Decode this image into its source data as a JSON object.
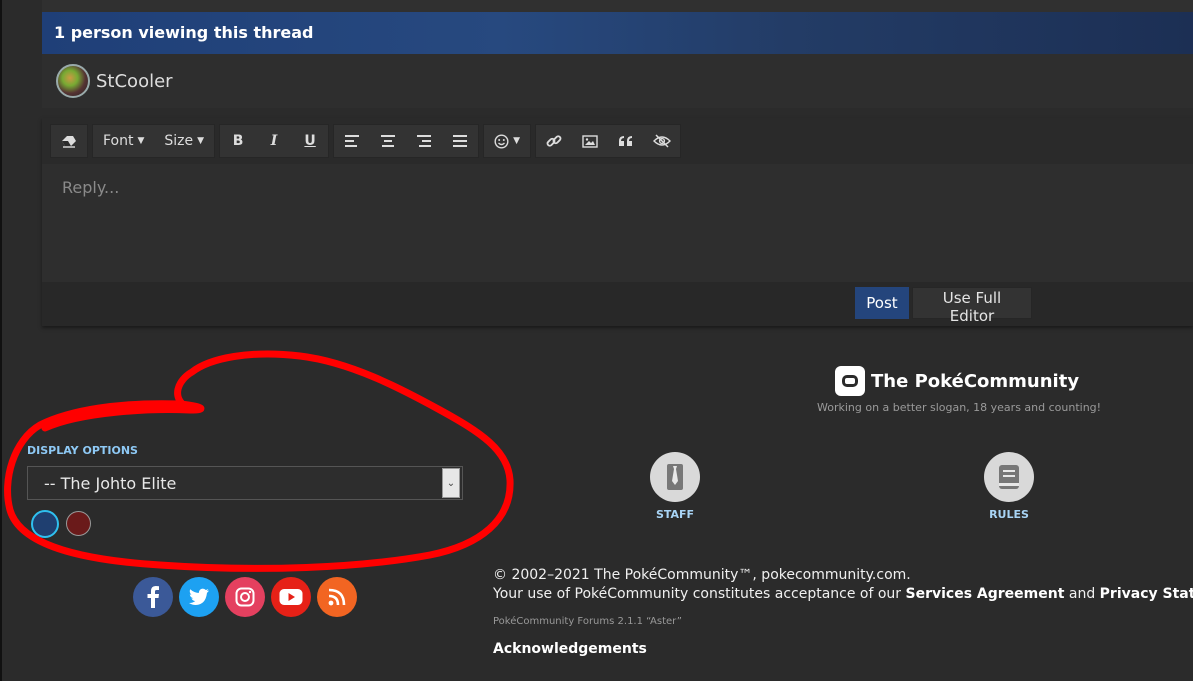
{
  "thread": {
    "viewing_text": "1 person viewing this thread",
    "viewer_name": "StCooler"
  },
  "editor": {
    "font_label": "Font",
    "size_label": "Size",
    "bold_label": "B",
    "italic_label": "I",
    "underline_label": "U",
    "placeholder": "Reply...",
    "post_label": "Post",
    "full_editor_label": "Use Full Editor"
  },
  "brand": {
    "name": "The PokéCommunity",
    "slogan": "Working on a better slogan, 18 years and counting!"
  },
  "footer_links": {
    "staff": "STAFF",
    "rules": "RULES"
  },
  "display_options": {
    "label": "DISPLAY OPTIONS",
    "selected_style": "-- The Johto Elite"
  },
  "footer": {
    "copyright": "© 2002–2021 The PokéCommunity™, pokecommunity.com.",
    "usage_prefix": "Your use of PokéCommunity constitutes acceptance of our ",
    "services_agreement": "Services Agreement",
    "usage_and": " and ",
    "privacy_statement": "Privacy Statement",
    "usage_suffix": ".",
    "version": "PokéCommunity Forums 2.1.1 “Aster”",
    "acknowledgements": "Acknowledgements"
  },
  "colors": {
    "accent_blue": "#24457c",
    "annotation_red": "#ff0000",
    "swatch_blue": "#1f3f70",
    "swatch_red": "#6a1a1a"
  }
}
